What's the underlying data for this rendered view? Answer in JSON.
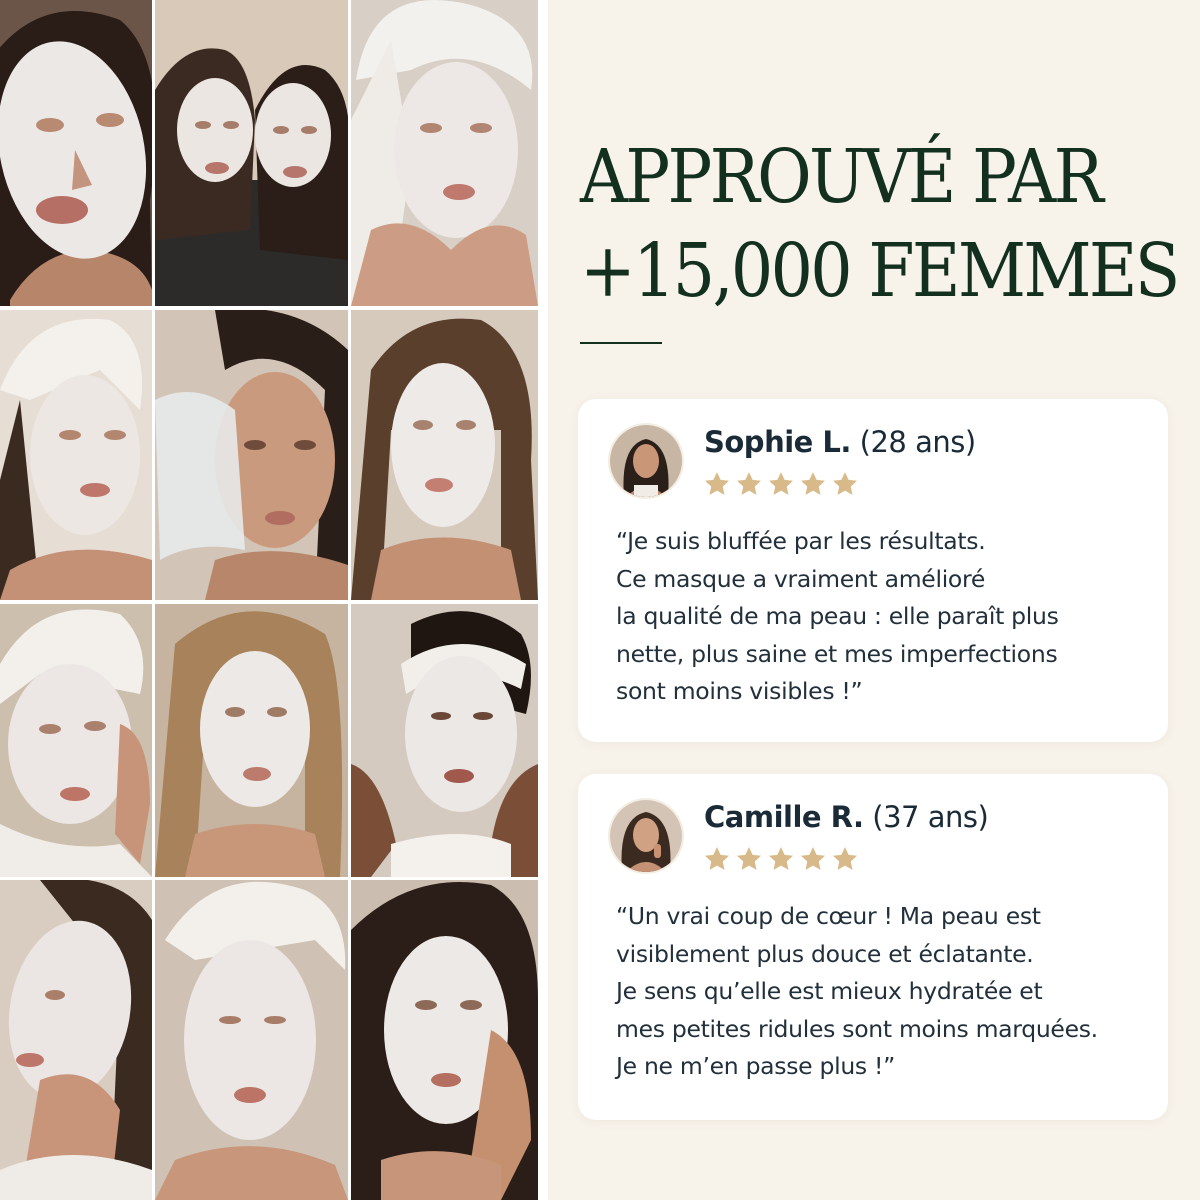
{
  "headline": {
    "line1": "APPROUVÉ PAR",
    "line2": "+15,000 FEMMES"
  },
  "colors": {
    "background": "#f7f2ea",
    "headline": "#13301f",
    "star": "#d8b98a",
    "card": "#ffffff",
    "text": "#22303b"
  },
  "photo_grid": {
    "rows": 4,
    "columns": 3,
    "alt_subject": "women wearing white sheet face masks"
  },
  "reviews": [
    {
      "name": "Sophie L.",
      "age": "(28 ans)",
      "rating": 5,
      "quote_lines": [
        "“Je suis bluffée par les résultats.",
        "Ce masque a vraiment amélioré",
        "la qualité de ma peau : elle paraît plus",
        "nette, plus saine et mes imperfections",
        "sont moins visibles !”"
      ]
    },
    {
      "name": "Camille R.",
      "age": "(37 ans)",
      "rating": 5,
      "quote_lines": [
        "“Un vrai coup de cœur ! Ma peau est",
        "visiblement plus douce et éclatante.",
        "Je sens qu’elle est mieux hydratée et",
        "mes petites ridules sont moins marquées.",
        "Je ne m’en passe plus !”"
      ]
    }
  ]
}
